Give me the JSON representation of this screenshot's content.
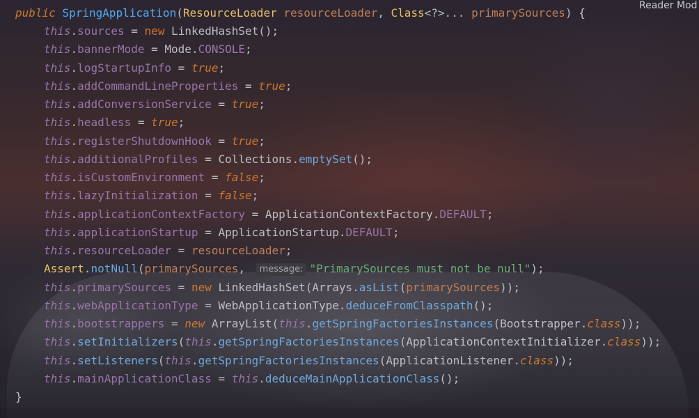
{
  "editor": {
    "reader_mode_label": "Reader Mod",
    "code": {
      "sig": {
        "kw_public": "public",
        "name": "SpringApplication",
        "open": "(",
        "t1": "ResourceLoader",
        "p1": "resourceLoader",
        "sep": ", ",
        "t2": "Class",
        "generic": "<?>... ",
        "p2": "primarySources",
        "close": ") {"
      },
      "l1": {
        "this": "this",
        "field": "sources",
        "op": " = ",
        "kw": "new",
        "rest": " LinkedHashSet();"
      },
      "l2": {
        "this": "this",
        "field": "bannerMode",
        "op": " = ",
        "type": "Mode",
        "dot": ".",
        "const": "CONSOLE",
        "end": ";"
      },
      "l3": {
        "this": "this",
        "field": "logStartupInfo",
        "op": " = ",
        "val": "true",
        "end": ";"
      },
      "l4": {
        "this": "this",
        "field": "addCommandLineProperties",
        "op": " = ",
        "val": "true",
        "end": ";"
      },
      "l5": {
        "this": "this",
        "field": "addConversionService",
        "op": " = ",
        "val": "true",
        "end": ";"
      },
      "l6": {
        "this": "this",
        "field": "headless",
        "op": " = ",
        "val": "true",
        "end": ";"
      },
      "l7": {
        "this": "this",
        "field": "registerShutdownHook",
        "op": " = ",
        "val": "true",
        "end": ";"
      },
      "l8": {
        "this": "this",
        "field": "additionalProfiles",
        "op": " = ",
        "type": "Collections",
        "dot": ".",
        "method": "emptySet",
        "end": "();"
      },
      "l9": {
        "this": "this",
        "field": "isCustomEnvironment",
        "op": " = ",
        "val": "false",
        "end": ";"
      },
      "l10": {
        "this": "this",
        "field": "lazyInitialization",
        "op": " = ",
        "val": "false",
        "end": ";"
      },
      "l11": {
        "this": "this",
        "field": "applicationContextFactory",
        "op": " = ",
        "type": "ApplicationContextFactory",
        "dot": ".",
        "const": "DEFAULT",
        "end": ";"
      },
      "l12": {
        "this": "this",
        "field": "applicationStartup",
        "op": " = ",
        "type": "ApplicationStartup",
        "dot": ".",
        "const": "DEFAULT",
        "end": ";"
      },
      "l13": {
        "this": "this",
        "field": "resourceLoader",
        "op": " = ",
        "param": "resourceLoader",
        "end": ";"
      },
      "l14": {
        "type": "Assert",
        "dot": ".",
        "method": "notNull",
        "open": "(",
        "param": "primarySources",
        "comma": ", ",
        "hint": "message:",
        "str": "\"PrimarySources must not be null\"",
        "end": ");"
      },
      "l15": {
        "this": "this",
        "field": "primarySources",
        "op": " = ",
        "kw": "new",
        "type": " LinkedHashSet(Arrays.",
        "method": "asList",
        "open": "(",
        "param": "primarySources",
        "end": "));"
      },
      "l16": {
        "this": "this",
        "field": "webApplicationType",
        "op": " = ",
        "type": "WebApplicationType",
        "dot": ".",
        "method": "deduceFromClasspath",
        "end": "();"
      },
      "l17": {
        "this": "this",
        "field": "bootstrappers",
        "op": " = ",
        "kw": "new",
        "type": " ArrayList(",
        "this2": "this",
        "dot": ".",
        "method": "getSpringFactoriesInstances",
        "open": "(",
        "type2": "Bootstrapper",
        "dot2": ".",
        "cls": "class",
        "end": "));"
      },
      "l18": {
        "this": "this",
        "dot": ".",
        "method": "setInitializers",
        "open": "(",
        "this2": "this",
        "dot2": ".",
        "method2": "getSpringFactoriesInstances",
        "open2": "(",
        "type": "ApplicationContextInitializer",
        "dot3": ".",
        "cls": "class",
        "end": "));"
      },
      "l19": {
        "this": "this",
        "dot": ".",
        "method": "setListeners",
        "open": "(",
        "this2": "this",
        "dot2": ".",
        "method2": "getSpringFactoriesInstances",
        "open2": "(",
        "type": "ApplicationListener",
        "dot3": ".",
        "cls": "class",
        "end": "));"
      },
      "l20": {
        "this": "this",
        "field": "mainApplicationClass",
        "op": " = ",
        "this2": "this",
        "dot": ".",
        "method": "deduceMainApplicationClass",
        "end": "();"
      },
      "close": "}"
    },
    "colors": {
      "keyword": "#cc7832",
      "this": "#9876aa",
      "method": "#6fa8dc",
      "type": "#e8bf6a",
      "parameter": "#c07e59",
      "string": "#6aab73",
      "text": "#bcbec4"
    }
  }
}
